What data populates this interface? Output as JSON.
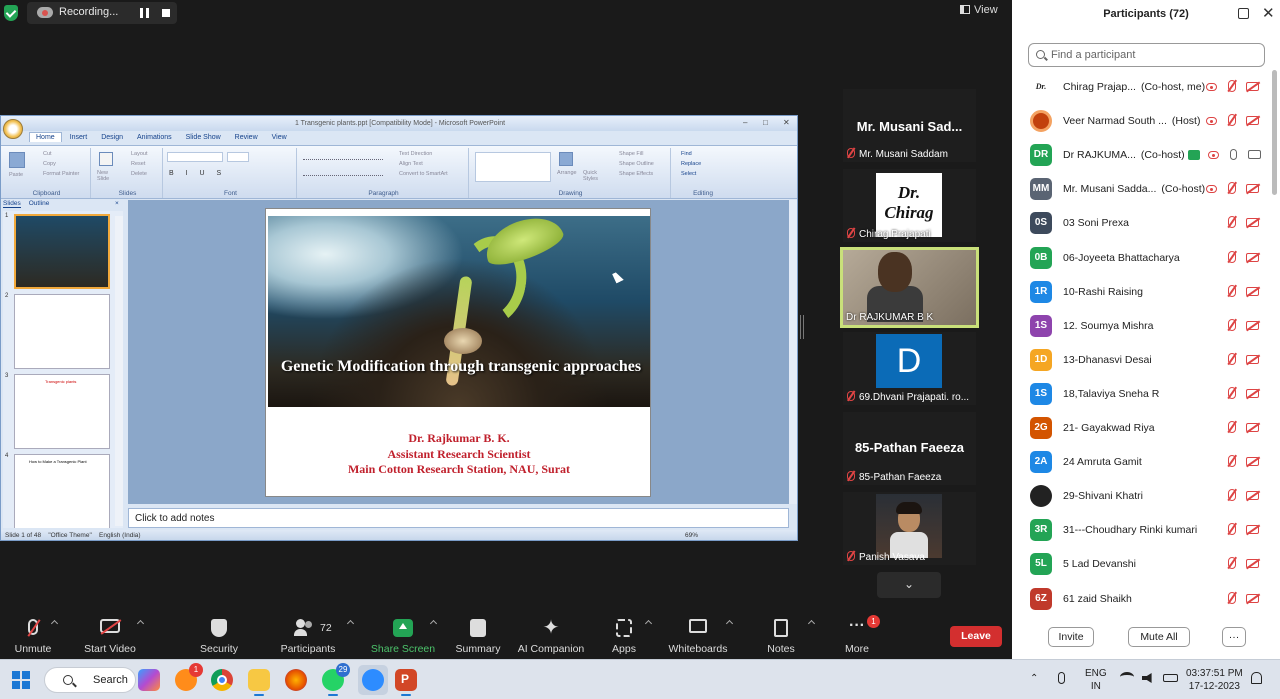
{
  "recording": {
    "label": "Recording..."
  },
  "view_label": "View",
  "ppt": {
    "window_title": "1 Transgenic plants.ppt [Compatibility Mode] - Microsoft PowerPoint",
    "tabs": [
      "Home",
      "Insert",
      "Design",
      "Animations",
      "Slide Show",
      "Review",
      "View"
    ],
    "groups": [
      "Clipboard",
      "Slides",
      "Font",
      "Paragraph",
      "Drawing",
      "Editing"
    ],
    "ribbon_items": {
      "paste": "Paste",
      "cut": "Cut",
      "copy": "Copy",
      "format_painter": "Format Painter",
      "new_slide": "New Slide",
      "layout": "Layout",
      "reset": "Reset",
      "delete": "Delete",
      "text_direction": "Text Direction",
      "align_text": "Align Text",
      "convert_smartart": "Convert to SmartArt",
      "shape_fill": "Shape Fill",
      "shape_outline": "Shape Outline",
      "shape_effects": "Shape Effects",
      "arrange": "Arrange",
      "quick_styles": "Quick Styles",
      "find": "Find",
      "replace": "Replace",
      "select": "Select"
    },
    "panel_tabs": [
      "Slides",
      "Outline"
    ],
    "thumb_numbers": [
      "1",
      "2",
      "3",
      "4"
    ],
    "thumb3_title": "Transgenic plants",
    "thumb4_title": "How to Make a Transgenic Plant",
    "slide": {
      "title": "Genetic Modification through transgenic approaches",
      "author_name": "Dr. Rajkumar B. K.",
      "author_role": "Assistant Research Scientist",
      "author_org": "Main Cotton Research Station,  NAU, Surat"
    },
    "notes_placeholder": "Click to add notes",
    "status": {
      "slide": "Slide 1 of 48",
      "theme": "\"Office Theme\"",
      "lang": "English (India)",
      "zoom": "69%"
    }
  },
  "video_tiles": [
    {
      "big": "Mr. Musani Sad...",
      "name": "Mr. Musani Saddam"
    },
    {
      "img_text": "Dr. Chirag",
      "name": "Chirag Prajapati"
    },
    {
      "name": "Dr RAJKUMAR B K"
    },
    {
      "letter": "D",
      "name": "69.Dhvani Prajapati. ro..."
    },
    {
      "big": "85-Pathan Faeeza",
      "name": "85-Pathan Faeeza"
    },
    {
      "name": "Panish Vasava"
    }
  ],
  "participants_panel": {
    "title": "Participants (72)",
    "search_placeholder": "Find a participant",
    "invite": "Invite",
    "mute_all": "Mute All",
    "more": "···",
    "rows": [
      {
        "initials": "Dr.",
        "color": "#ffffff",
        "name": "Chirag Prajap...",
        "role": "(Co-host, me)"
      },
      {
        "initials": "",
        "color": "#c2410c",
        "name": "Veer Narmad South ...",
        "role": "(Host)"
      },
      {
        "initials": "DR",
        "color": "#23a455",
        "name": "Dr RAJKUMA...",
        "role": "(Co-host)"
      },
      {
        "initials": "MM",
        "color": "#5a6473",
        "name": "Mr. Musani Sadda...",
        "role": "(Co-host)"
      },
      {
        "initials": "0S",
        "color": "#3d4a5c",
        "name": "03 Soni Prexa",
        "role": ""
      },
      {
        "initials": "0B",
        "color": "#23a455",
        "name": "06-Joyeeta Bhattacharya",
        "role": ""
      },
      {
        "initials": "1R",
        "color": "#1e88e5",
        "name": "10-Rashi Raising",
        "role": ""
      },
      {
        "initials": "1S",
        "color": "#8e44ad",
        "name": "12. Soumya Mishra",
        "role": ""
      },
      {
        "initials": "1D",
        "color": "#f5a623",
        "name": "13-Dhanasvi Desai",
        "role": ""
      },
      {
        "initials": "1S",
        "color": "#1e88e5",
        "name": "18,Talaviya Sneha R",
        "role": ""
      },
      {
        "initials": "2G",
        "color": "#d35400",
        "name": "21- Gayakwad Riya",
        "role": ""
      },
      {
        "initials": "2A",
        "color": "#1e88e5",
        "name": "24 Amruta Gamit",
        "role": ""
      },
      {
        "initials": "",
        "color": "#222222",
        "name": "29-Shivani Khatri",
        "role": ""
      },
      {
        "initials": "3R",
        "color": "#23a455",
        "name": "31---Choudhary Rinki kumari",
        "role": ""
      },
      {
        "initials": "5L",
        "color": "#23a455",
        "name": "5 Lad Devanshi",
        "role": ""
      },
      {
        "initials": "6Z",
        "color": "#c0392b",
        "name": "61 zaid Shaikh",
        "role": ""
      }
    ]
  },
  "toolbar": {
    "unmute": "Unmute",
    "start_video": "Start Video",
    "security": "Security",
    "participants": "Participants",
    "participants_count": "72",
    "share_screen": "Share Screen",
    "summary": "Summary",
    "ai_companion": "AI Companion",
    "apps": "Apps",
    "whiteboards": "Whiteboards",
    "notes": "Notes",
    "more": "More",
    "more_badge": "1",
    "leave": "Leave"
  },
  "taskbar": {
    "search": "Search",
    "badge1": "1",
    "whatsapp_badge": "29",
    "lang": "ENG",
    "region": "IN",
    "time": "03:37:51 PM",
    "date": "17-12-2023"
  }
}
